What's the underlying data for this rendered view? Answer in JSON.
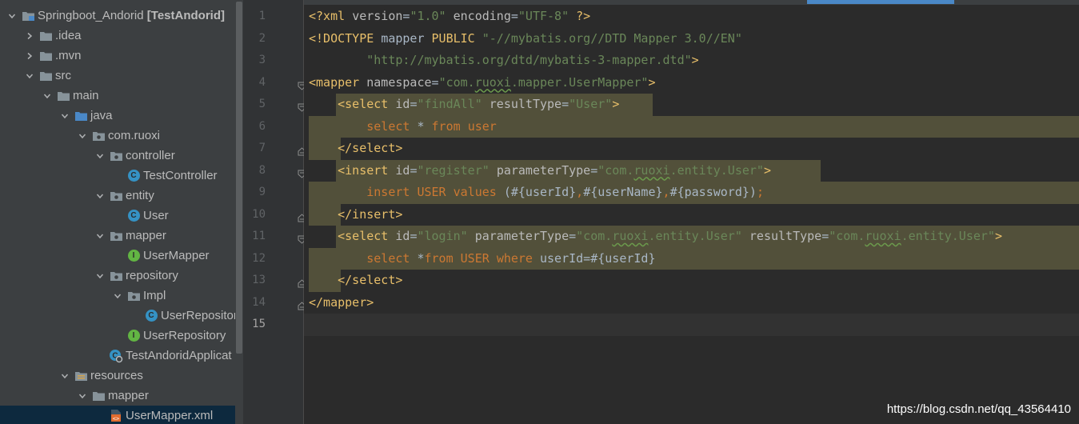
{
  "project_tree": [
    {
      "label": "Springboot_Andorid",
      "bold": "[TestAndorid]",
      "icon": "module-folder-icon",
      "arrow": "down",
      "indent": 0
    },
    {
      "label": ".idea",
      "icon": "folder-icon",
      "arrow": "right",
      "indent": 1
    },
    {
      "label": ".mvn",
      "icon": "folder-icon",
      "arrow": "right",
      "indent": 1
    },
    {
      "label": "src",
      "icon": "folder-icon",
      "arrow": "down",
      "indent": 1
    },
    {
      "label": "main",
      "icon": "folder-icon",
      "arrow": "down",
      "indent": 2
    },
    {
      "label": "java",
      "icon": "source-folder-icon",
      "arrow": "down",
      "indent": 3
    },
    {
      "label": "com.ruoxi",
      "icon": "package-icon",
      "arrow": "down",
      "indent": 4
    },
    {
      "label": "controller",
      "icon": "package-icon",
      "arrow": "down",
      "indent": 5
    },
    {
      "label": "TestController",
      "icon": "class-icon",
      "arrow": "",
      "indent": 6
    },
    {
      "label": "entity",
      "icon": "package-icon",
      "arrow": "down",
      "indent": 5
    },
    {
      "label": "User",
      "icon": "class-icon",
      "arrow": "",
      "indent": 6
    },
    {
      "label": "mapper",
      "icon": "package-icon",
      "arrow": "down",
      "indent": 5
    },
    {
      "label": "UserMapper",
      "icon": "interface-icon",
      "arrow": "",
      "indent": 6
    },
    {
      "label": "repository",
      "icon": "package-icon",
      "arrow": "down",
      "indent": 5
    },
    {
      "label": "Impl",
      "icon": "package-icon",
      "arrow": "down",
      "indent": 6
    },
    {
      "label": "UserRepositor",
      "icon": "class-icon",
      "arrow": "",
      "indent": 7
    },
    {
      "label": "UserRepository",
      "icon": "interface-icon",
      "arrow": "",
      "indent": 6
    },
    {
      "label": "TestAndoridApplicat",
      "icon": "spring-boot-class-icon",
      "arrow": "",
      "indent": 5
    },
    {
      "label": "resources",
      "icon": "resources-folder-icon",
      "arrow": "down",
      "indent": 3
    },
    {
      "label": "mapper",
      "icon": "folder-icon",
      "arrow": "down",
      "indent": 4
    },
    {
      "label": "UserMapper.xml",
      "icon": "xml-file-icon",
      "arrow": "",
      "indent": 5,
      "selected": true
    }
  ],
  "line_numbers": [
    "1",
    "2",
    "3",
    "4",
    "5",
    "6",
    "7",
    "8",
    "9",
    "10",
    "11",
    "12",
    "13",
    "14",
    "15"
  ],
  "code_lines": [
    [
      {
        "c": "t",
        "x": "<?xml "
      },
      {
        "c": "a",
        "x": "version"
      },
      {
        "c": "s",
        "x": "="
      },
      {
        "c": "v",
        "x": "\"1.0\""
      },
      {
        "c": "s",
        "x": " "
      },
      {
        "c": "a",
        "x": "encoding"
      },
      {
        "c": "s",
        "x": "="
      },
      {
        "c": "v",
        "x": "\"UTF-8\""
      },
      {
        "c": "t",
        "x": " ?>"
      }
    ],
    [
      {
        "c": "t",
        "x": "<!DOCTYPE "
      },
      {
        "c": "s",
        "x": "mapper "
      },
      {
        "c": "t",
        "x": "PUBLIC "
      },
      {
        "c": "v",
        "x": "\"-//mybatis.org//DTD Mapper 3.0//EN\""
      }
    ],
    [
      {
        "c": "s",
        "x": "        "
      },
      {
        "c": "v",
        "x": "\"http://mybatis.org/dtd/mybatis-3-mapper.dtd\""
      },
      {
        "c": "t",
        "x": ">"
      }
    ],
    [
      {
        "c": "t",
        "x": "<mapper "
      },
      {
        "c": "a",
        "x": "namespace"
      },
      {
        "c": "s",
        "x": "="
      },
      {
        "c": "v",
        "x": "\"com."
      },
      {
        "c": "vu",
        "x": "ruoxi"
      },
      {
        "c": "v",
        "x": ".mapper.UserMapper\""
      },
      {
        "c": "t",
        "x": ">"
      }
    ],
    [
      {
        "c": "s",
        "x": "    "
      },
      {
        "c": "t",
        "x": "<select "
      },
      {
        "c": "a",
        "x": "id"
      },
      {
        "c": "s",
        "x": "="
      },
      {
        "c": "v",
        "x": "\"findAll\""
      },
      {
        "c": "s",
        "x": " "
      },
      {
        "c": "a",
        "x": "resultType"
      },
      {
        "c": "s",
        "x": "="
      },
      {
        "c": "v",
        "x": "\"User\""
      },
      {
        "c": "t",
        "x": ">"
      }
    ],
    [
      {
        "c": "s",
        "x": "        "
      },
      {
        "c": "k",
        "x": "select "
      },
      {
        "c": "s",
        "x": "* "
      },
      {
        "c": "k",
        "x": "from "
      },
      {
        "c": "k",
        "x": "user"
      }
    ],
    [
      {
        "c": "s",
        "x": "    "
      },
      {
        "c": "t",
        "x": "</select>"
      }
    ],
    [
      {
        "c": "s",
        "x": "    "
      },
      {
        "c": "t",
        "x": "<insert "
      },
      {
        "c": "a",
        "x": "id"
      },
      {
        "c": "s",
        "x": "="
      },
      {
        "c": "v",
        "x": "\"register\""
      },
      {
        "c": "s",
        "x": " "
      },
      {
        "c": "a",
        "x": "parameterType"
      },
      {
        "c": "s",
        "x": "="
      },
      {
        "c": "v",
        "x": "\"com."
      },
      {
        "c": "vu",
        "x": "ruoxi"
      },
      {
        "c": "v",
        "x": ".entity.User\""
      },
      {
        "c": "t",
        "x": ">"
      }
    ],
    [
      {
        "c": "s",
        "x": "        "
      },
      {
        "c": "k",
        "x": "insert "
      },
      {
        "c": "k",
        "x": "USER "
      },
      {
        "c": "k",
        "x": "values "
      },
      {
        "c": "s",
        "x": "(#{userId}"
      },
      {
        "c": "k",
        "x": ","
      },
      {
        "c": "s",
        "x": "#{userName}"
      },
      {
        "c": "k",
        "x": ","
      },
      {
        "c": "s",
        "x": "#{password})"
      },
      {
        "c": "k",
        "x": ";"
      }
    ],
    [
      {
        "c": "s",
        "x": "    "
      },
      {
        "c": "t",
        "x": "</insert>"
      }
    ],
    [
      {
        "c": "s",
        "x": "    "
      },
      {
        "c": "t",
        "x": "<select "
      },
      {
        "c": "a",
        "x": "id"
      },
      {
        "c": "s",
        "x": "="
      },
      {
        "c": "v",
        "x": "\"login\""
      },
      {
        "c": "s",
        "x": " "
      },
      {
        "c": "a",
        "x": "parameterType"
      },
      {
        "c": "s",
        "x": "="
      },
      {
        "c": "v",
        "x": "\"com."
      },
      {
        "c": "vu",
        "x": "ruoxi"
      },
      {
        "c": "v",
        "x": ".entity.User\""
      },
      {
        "c": "s",
        "x": " "
      },
      {
        "c": "a",
        "x": "resultType"
      },
      {
        "c": "s",
        "x": "="
      },
      {
        "c": "v",
        "x": "\"com."
      },
      {
        "c": "vu",
        "x": "ruoxi"
      },
      {
        "c": "v",
        "x": ".entity.User\""
      },
      {
        "c": "t",
        "x": ">"
      }
    ],
    [
      {
        "c": "s",
        "x": "        "
      },
      {
        "c": "k",
        "x": "select "
      },
      {
        "c": "s",
        "x": "*"
      },
      {
        "c": "k",
        "x": "from "
      },
      {
        "c": "k",
        "x": "USER "
      },
      {
        "c": "k",
        "x": "where "
      },
      {
        "c": "s",
        "x": "userId=#{userId}"
      }
    ],
    [
      {
        "c": "s",
        "x": "    "
      },
      {
        "c": "t",
        "x": "</select>"
      }
    ],
    [
      {
        "c": "t",
        "x": "</mapper>"
      }
    ],
    []
  ],
  "highlights": {
    "5": "tag",
    "6": "body",
    "7": "end",
    "8": "tag",
    "9": "body",
    "10": "end",
    "11": "tag",
    "12": "body",
    "13": "end"
  },
  "current_line": "15",
  "colors": {
    "tree_bg": "#3c3f41",
    "editor_bg": "#2b2b2b",
    "gutter_bg": "#313335",
    "tag": "#e8bf6a",
    "string": "#6a8759",
    "keyword": "#cc7832",
    "match_highlight": "#52503a",
    "selection": "#0d293e"
  },
  "watermark": "https://blog.csdn.net/qq_43564410"
}
